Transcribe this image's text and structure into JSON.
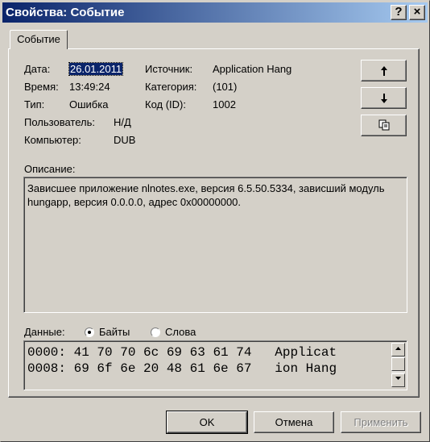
{
  "window": {
    "title": "Свойства: Событие",
    "help_btn": "?",
    "close_btn": "×"
  },
  "tab": {
    "label": "Событие"
  },
  "fields": {
    "date_label": "Дата:",
    "date_value": "26.01.2011",
    "time_label": "Время:",
    "time_value": "13:49:24",
    "type_label": "Тип:",
    "type_value": "Ошибка",
    "user_label": "Пользователь:",
    "user_value": "Н/Д",
    "computer_label": "Компьютер:",
    "computer_value": "DUB",
    "source_label": "Источник:",
    "source_value": "Application Hang",
    "category_label": "Категория:",
    "category_value": "(101)",
    "code_label": "Код (ID):",
    "code_value": "1002"
  },
  "description": {
    "label": "Описание:",
    "text": "Зависшее приложение nlnotes.exe, версия 6.5.50.5334, зависший модуль hungapp, версия 0.0.0.0, адрес 0x00000000."
  },
  "data_section": {
    "label": "Данные:",
    "radio_bytes": "Байты",
    "radio_words": "Слова",
    "selected": "Байты",
    "lines": [
      "0000: 41 70 70 6c 69 63 61 74   Applicat",
      "0008: 69 6f 6e 20 48 61 6e 67   ion Hang"
    ]
  },
  "icons": {
    "up": "arrow-up-icon",
    "down": "arrow-down-icon",
    "copy": "copy-icon"
  },
  "buttons": {
    "ok": "OK",
    "cancel": "Отмена",
    "apply": "Применить"
  }
}
